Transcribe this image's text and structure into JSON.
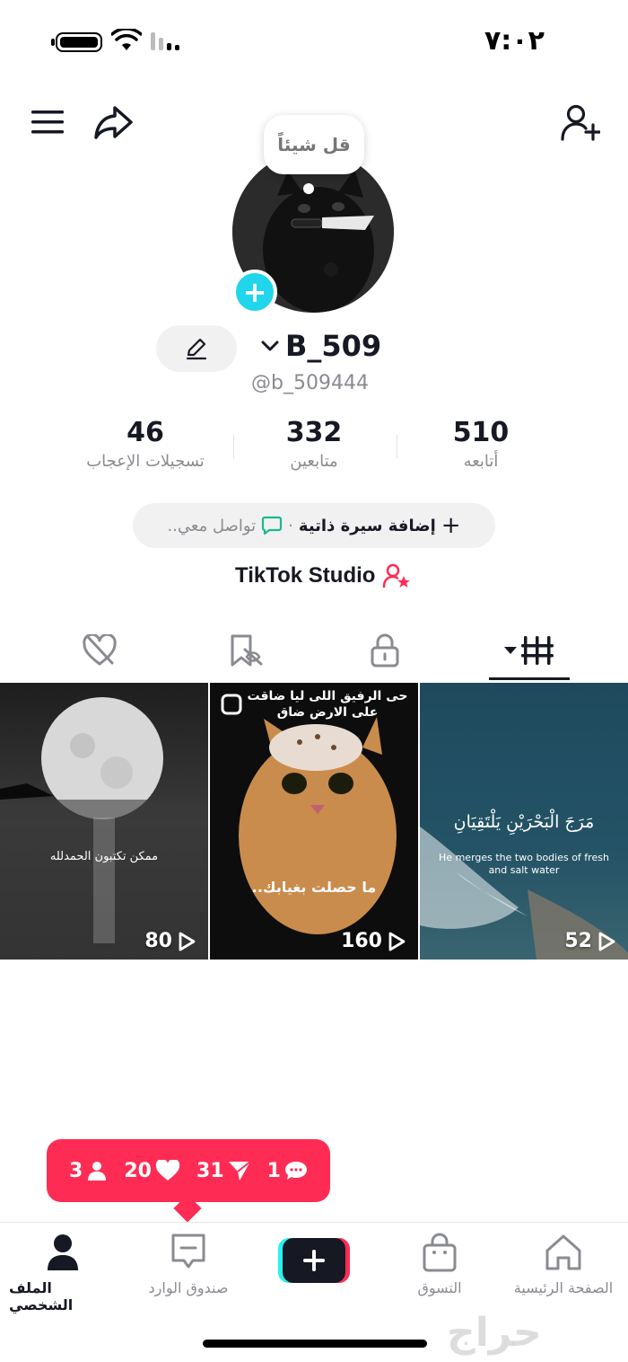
{
  "status_bar": {
    "time": "٧:٠٢"
  },
  "header": {
    "menu_icon": "hamburger-icon",
    "share_icon": "share-arrow-icon",
    "add_friend_icon": "add-user-icon"
  },
  "profile": {
    "note_bubble": "قل شيئاً",
    "display_name": "B_509",
    "username": "@b_509444",
    "stats": [
      {
        "value": "46",
        "label": "تسجيلات الإعجاب"
      },
      {
        "value": "332",
        "label": "متابعين"
      },
      {
        "value": "510",
        "label": "أتابعه"
      }
    ],
    "bio_add": "إضافة سيرة ذاتية",
    "bio_separator": "·",
    "bio_contact": "تواصل معي..",
    "studio_link": "TikTok Studio"
  },
  "tabs": [
    {
      "icon": "liked-videos-icon"
    },
    {
      "icon": "favorites-icon"
    },
    {
      "icon": "private-lock-icon"
    },
    {
      "icon": "videos-grid-icon",
      "active": true
    }
  ],
  "videos": [
    {
      "views": "80",
      "caption": "ممكن تكتبون الحمدلله"
    },
    {
      "views": "160",
      "caption_top": "حى الرفيق اللى ليا ضاقت على الارض ضاق",
      "caption_bottom": "..ما حصلت بغيابك"
    },
    {
      "views": "52",
      "caption_ar": "مَرَجَ الْبَحْرَيْنِ يَلْتَقِيَانِ",
      "caption_en": "He merges the two bodies of fresh and salt water"
    }
  ],
  "notification": {
    "followers": "3",
    "likes": "20",
    "shares": "31",
    "comments": "1"
  },
  "bottom_nav": [
    {
      "label": "الملف الشخصي",
      "icon": "profile-icon",
      "active": true
    },
    {
      "label": "صندوق الوارد",
      "icon": "inbox-icon"
    },
    {
      "label": "",
      "icon": "create-plus-icon"
    },
    {
      "label": "التسوق",
      "icon": "shop-bag-icon"
    },
    {
      "label": "الصفحة الرئيسية",
      "icon": "home-icon"
    }
  ],
  "watermark": "حراج",
  "colors": {
    "accent": "#fe2c55",
    "cyan": "#20d5ec",
    "text": "#161823",
    "muted": "#8a8b91"
  }
}
